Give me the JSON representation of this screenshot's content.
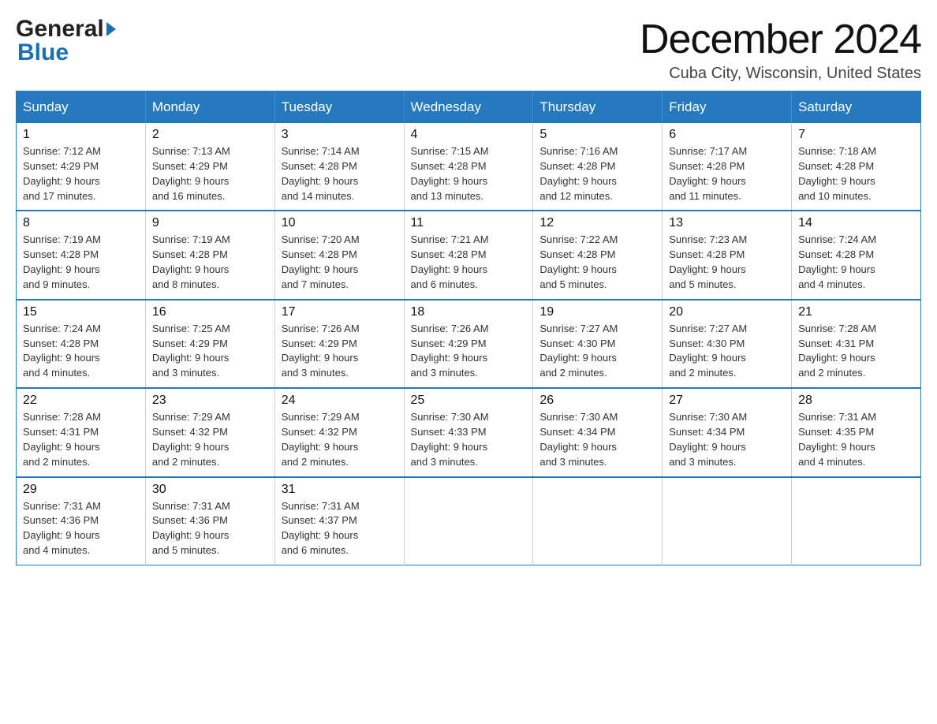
{
  "logo": {
    "general": "General",
    "blue": "Blue"
  },
  "header": {
    "month": "December 2024",
    "location": "Cuba City, Wisconsin, United States"
  },
  "days_of_week": [
    "Sunday",
    "Monday",
    "Tuesday",
    "Wednesday",
    "Thursday",
    "Friday",
    "Saturday"
  ],
  "weeks": [
    [
      {
        "day": "1",
        "sunrise": "7:12 AM",
        "sunset": "4:29 PM",
        "daylight": "9 hours and 17 minutes."
      },
      {
        "day": "2",
        "sunrise": "7:13 AM",
        "sunset": "4:29 PM",
        "daylight": "9 hours and 16 minutes."
      },
      {
        "day": "3",
        "sunrise": "7:14 AM",
        "sunset": "4:28 PM",
        "daylight": "9 hours and 14 minutes."
      },
      {
        "day": "4",
        "sunrise": "7:15 AM",
        "sunset": "4:28 PM",
        "daylight": "9 hours and 13 minutes."
      },
      {
        "day": "5",
        "sunrise": "7:16 AM",
        "sunset": "4:28 PM",
        "daylight": "9 hours and 12 minutes."
      },
      {
        "day": "6",
        "sunrise": "7:17 AM",
        "sunset": "4:28 PM",
        "daylight": "9 hours and 11 minutes."
      },
      {
        "day": "7",
        "sunrise": "7:18 AM",
        "sunset": "4:28 PM",
        "daylight": "9 hours and 10 minutes."
      }
    ],
    [
      {
        "day": "8",
        "sunrise": "7:19 AM",
        "sunset": "4:28 PM",
        "daylight": "9 hours and 9 minutes."
      },
      {
        "day": "9",
        "sunrise": "7:19 AM",
        "sunset": "4:28 PM",
        "daylight": "9 hours and 8 minutes."
      },
      {
        "day": "10",
        "sunrise": "7:20 AM",
        "sunset": "4:28 PM",
        "daylight": "9 hours and 7 minutes."
      },
      {
        "day": "11",
        "sunrise": "7:21 AM",
        "sunset": "4:28 PM",
        "daylight": "9 hours and 6 minutes."
      },
      {
        "day": "12",
        "sunrise": "7:22 AM",
        "sunset": "4:28 PM",
        "daylight": "9 hours and 5 minutes."
      },
      {
        "day": "13",
        "sunrise": "7:23 AM",
        "sunset": "4:28 PM",
        "daylight": "9 hours and 5 minutes."
      },
      {
        "day": "14",
        "sunrise": "7:24 AM",
        "sunset": "4:28 PM",
        "daylight": "9 hours and 4 minutes."
      }
    ],
    [
      {
        "day": "15",
        "sunrise": "7:24 AM",
        "sunset": "4:28 PM",
        "daylight": "9 hours and 4 minutes."
      },
      {
        "day": "16",
        "sunrise": "7:25 AM",
        "sunset": "4:29 PM",
        "daylight": "9 hours and 3 minutes."
      },
      {
        "day": "17",
        "sunrise": "7:26 AM",
        "sunset": "4:29 PM",
        "daylight": "9 hours and 3 minutes."
      },
      {
        "day": "18",
        "sunrise": "7:26 AM",
        "sunset": "4:29 PM",
        "daylight": "9 hours and 3 minutes."
      },
      {
        "day": "19",
        "sunrise": "7:27 AM",
        "sunset": "4:30 PM",
        "daylight": "9 hours and 2 minutes."
      },
      {
        "day": "20",
        "sunrise": "7:27 AM",
        "sunset": "4:30 PM",
        "daylight": "9 hours and 2 minutes."
      },
      {
        "day": "21",
        "sunrise": "7:28 AM",
        "sunset": "4:31 PM",
        "daylight": "9 hours and 2 minutes."
      }
    ],
    [
      {
        "day": "22",
        "sunrise": "7:28 AM",
        "sunset": "4:31 PM",
        "daylight": "9 hours and 2 minutes."
      },
      {
        "day": "23",
        "sunrise": "7:29 AM",
        "sunset": "4:32 PM",
        "daylight": "9 hours and 2 minutes."
      },
      {
        "day": "24",
        "sunrise": "7:29 AM",
        "sunset": "4:32 PM",
        "daylight": "9 hours and 2 minutes."
      },
      {
        "day": "25",
        "sunrise": "7:30 AM",
        "sunset": "4:33 PM",
        "daylight": "9 hours and 3 minutes."
      },
      {
        "day": "26",
        "sunrise": "7:30 AM",
        "sunset": "4:34 PM",
        "daylight": "9 hours and 3 minutes."
      },
      {
        "day": "27",
        "sunrise": "7:30 AM",
        "sunset": "4:34 PM",
        "daylight": "9 hours and 3 minutes."
      },
      {
        "day": "28",
        "sunrise": "7:31 AM",
        "sunset": "4:35 PM",
        "daylight": "9 hours and 4 minutes."
      }
    ],
    [
      {
        "day": "29",
        "sunrise": "7:31 AM",
        "sunset": "4:36 PM",
        "daylight": "9 hours and 4 minutes."
      },
      {
        "day": "30",
        "sunrise": "7:31 AM",
        "sunset": "4:36 PM",
        "daylight": "9 hours and 5 minutes."
      },
      {
        "day": "31",
        "sunrise": "7:31 AM",
        "sunset": "4:37 PM",
        "daylight": "9 hours and 6 minutes."
      },
      null,
      null,
      null,
      null
    ]
  ],
  "labels": {
    "sunrise": "Sunrise:",
    "sunset": "Sunset:",
    "daylight": "Daylight:"
  }
}
